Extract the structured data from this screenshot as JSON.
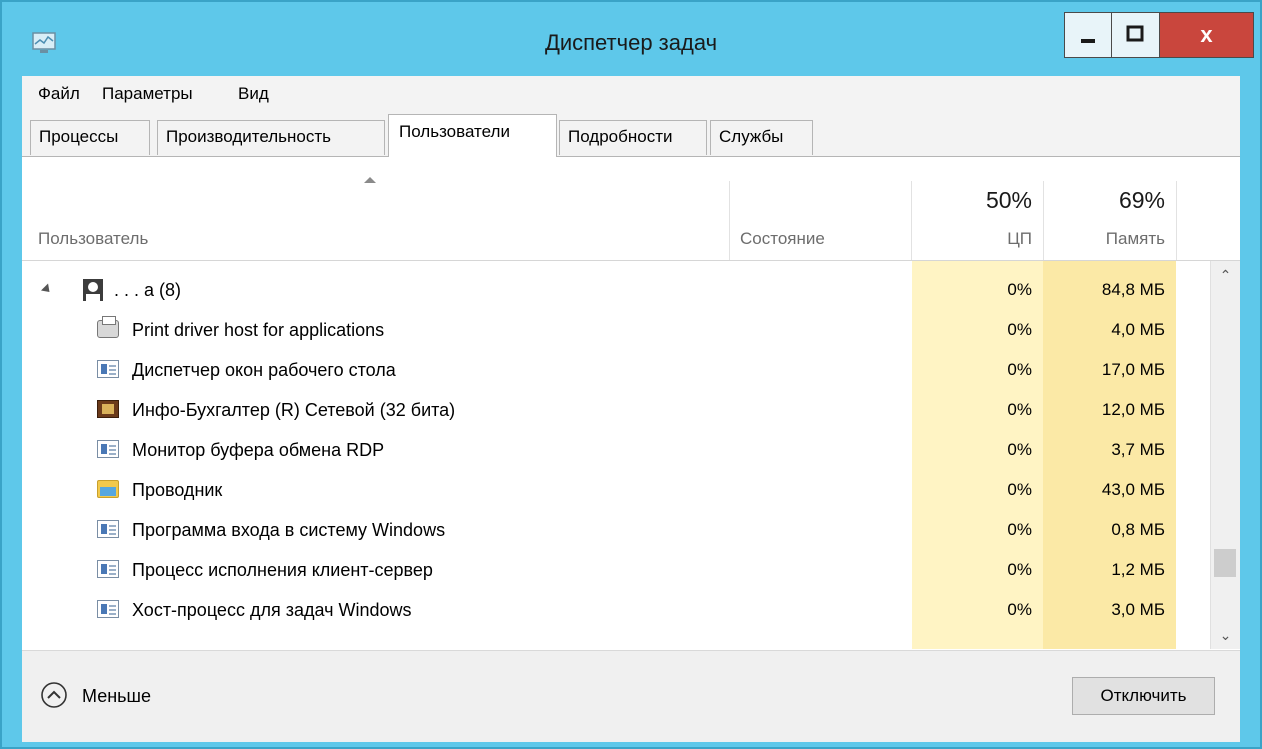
{
  "window": {
    "title": "Диспетчер задач",
    "app_icon": "task-manager-icon",
    "close_label": "x",
    "colors": {
      "frame": "#5ec8ea",
      "close": "#c9463d",
      "cpu_col": "#fff4c4",
      "mem_col": "#fbe9a6"
    }
  },
  "menu": {
    "file": "Файл",
    "options": "Параметры",
    "view": "Вид"
  },
  "tabs": [
    {
      "label": "Процессы"
    },
    {
      "label": "Производительность"
    },
    {
      "label": "Пользователи",
      "active": true
    },
    {
      "label": "Подробности"
    },
    {
      "label": "Службы"
    }
  ],
  "columns": {
    "user": "Пользователь",
    "status": "Состояние",
    "cpu_pct": "50%",
    "cpu": "ЦП",
    "mem_pct": "69%",
    "mem": "Память"
  },
  "user_row": {
    "name": ". . .     a (8)",
    "cpu": "0%",
    "mem": "84,8 МБ",
    "icon": "user-icon"
  },
  "processes": [
    {
      "name": "Print driver host for applications",
      "cpu": "0%",
      "mem": "4,0 МБ",
      "icon": "printer-icon"
    },
    {
      "name": "Диспетчер окон рабочего стола",
      "cpu": "0%",
      "mem": "17,0 МБ",
      "icon": "window-app-icon"
    },
    {
      "name": "Инфо-Бухгалтер (R) Сетевой (32 бита)",
      "cpu": "0%",
      "mem": "12,0 МБ",
      "icon": "book-app-icon"
    },
    {
      "name": "Монитор буфера обмена RDP",
      "cpu": "0%",
      "mem": "3,7 МБ",
      "icon": "window-app-icon"
    },
    {
      "name": "Проводник",
      "cpu": "0%",
      "mem": "43,0 МБ",
      "icon": "folder-icon"
    },
    {
      "name": "Программа входа в систему Windows",
      "cpu": "0%",
      "mem": "0,8 МБ",
      "icon": "window-app-icon"
    },
    {
      "name": "Процесс исполнения клиент-сервер",
      "cpu": "0%",
      "mem": "1,2 МБ",
      "icon": "window-app-icon"
    },
    {
      "name": "Хост-процесс для задач Windows",
      "cpu": "0%",
      "mem": "3,0 МБ",
      "icon": "window-app-icon"
    }
  ],
  "footer": {
    "fewer_label": "Меньше",
    "disconnect_label": "Отключить"
  }
}
